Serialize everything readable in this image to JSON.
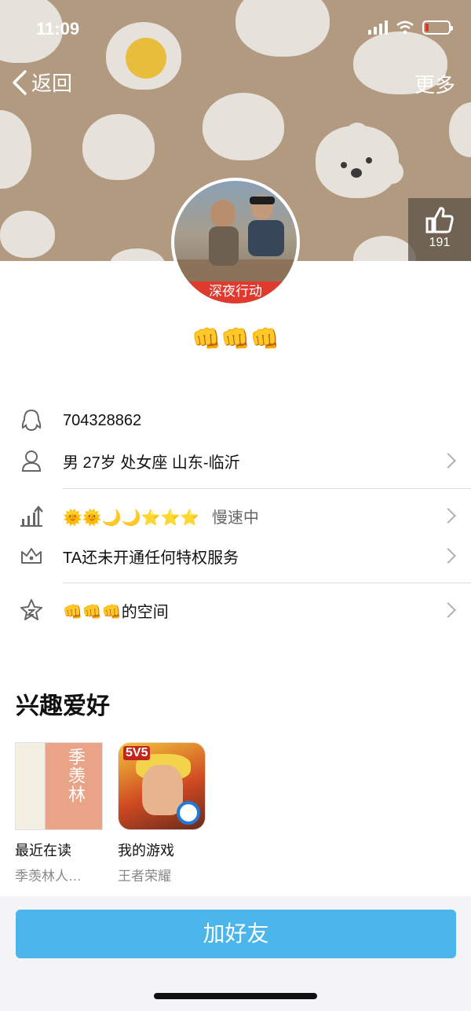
{
  "status_bar": {
    "time": "11:09"
  },
  "nav": {
    "back_label": "返回",
    "more_label": "更多"
  },
  "like": {
    "count": "191"
  },
  "avatar": {
    "badge_text": "深夜行动"
  },
  "profile": {
    "nickname": "👊👊👊",
    "qq_number": "704328862",
    "details": "男 27岁 处女座 山东-临沂",
    "level_icons": "🌞🌞🌙🌙⭐⭐⭐",
    "level_status": "慢速中",
    "privilege": "TA还未开通任何特权服务",
    "space": "👊👊👊的空间"
  },
  "interests": {
    "title": "兴趣爱好",
    "items": [
      {
        "title": "最近在读",
        "desc": "季羡林人…",
        "cover_text": "季羡林"
      },
      {
        "title": "我的游戏",
        "desc": "王者荣耀",
        "cover_tag": "5V5"
      }
    ]
  },
  "actions": {
    "add_friend": "加好友"
  },
  "colors": {
    "banner": "#b29a80",
    "primary_button": "#4bb5ec",
    "badge_red": "#e0392e"
  }
}
